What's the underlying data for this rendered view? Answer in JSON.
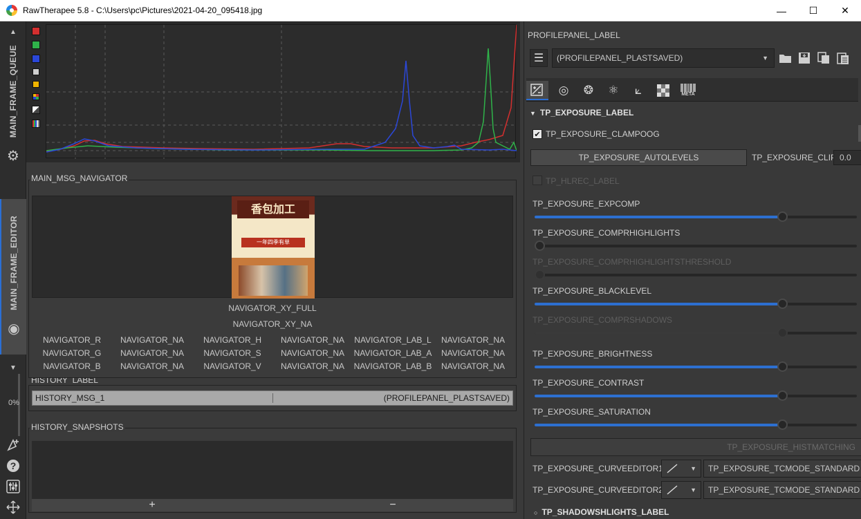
{
  "window": {
    "title": "RawTherapee 5.8 - C:\\Users\\pc\\Pictures\\2021-04-20_095418.jpg",
    "minimize": "—",
    "maximize": "☐",
    "close": "✕"
  },
  "sidebar": {
    "queue_tab": "MAIN_FRAME_QUEUE",
    "editor_tab": "MAIN_FRAME_EDITOR",
    "progress": "0%"
  },
  "navigator": {
    "label": "MAIN_MSG_NAVIGATOR",
    "xy_full": "NAVIGATOR_XY_FULL",
    "xy_na": "NAVIGATOR_XY_NA",
    "grid": [
      [
        "NAVIGATOR_R",
        "NAVIGATOR_NA",
        "NAVIGATOR_H",
        "NAVIGATOR_NA",
        "NAVIGATOR_LAB_L",
        "NAVIGATOR_NA"
      ],
      [
        "NAVIGATOR_G",
        "NAVIGATOR_NA",
        "NAVIGATOR_S",
        "NAVIGATOR_NA",
        "NAVIGATOR_LAB_A",
        "NAVIGATOR_NA"
      ],
      [
        "NAVIGATOR_B",
        "NAVIGATOR_NA",
        "NAVIGATOR_V",
        "NAVIGATOR_NA",
        "NAVIGATOR_LAB_B",
        "NAVIGATOR_NA"
      ]
    ],
    "thumb_title": "香包加工",
    "thumb_sub": "一年四季有单"
  },
  "history": {
    "label": "HISTORY_LABEL",
    "row_left": "HISTORY_MSG_1",
    "row_right": "(PROFILEPANEL_PLASTSAVED)"
  },
  "snapshots": {
    "label": "HISTORY_SNAPSHOTS",
    "add": "+",
    "remove": "−"
  },
  "profile": {
    "label": "PROFILEPANEL_LABEL",
    "value": "(PROFILEPANEL_PLASTSAVED)"
  },
  "tool_tabs": [
    "exposure-tab",
    "detail-tab",
    "color-tab",
    "advanced-tab",
    "transform-tab",
    "raw-tab",
    "meta-tab"
  ],
  "meta_tab_label": "META",
  "exposure": {
    "section": "TP_EXPOSURE_LABEL",
    "clamp": "TP_EXPOSURE_CLAMPOOG",
    "autolevels": "TP_EXPOSURE_AUTOLEVELS",
    "clip_label": "TP_EXPOSURE_CLIP",
    "clip_value": "0.0",
    "hlrec": "TP_HLREC_LABEL",
    "expcomp": "TP_EXPOSURE_EXPCOMP",
    "comprhighlights": "TP_EXPOSURE_COMPRHIGHLIGHTS",
    "comprhighlightsthreshold": "TP_EXPOSURE_COMPRHIGHLIGHTSTHRESHOLD",
    "blacklevel": "TP_EXPOSURE_BLACKLEVEL",
    "comprshadows": "TP_EXPOSURE_COMPRSHADOWS",
    "brightness": "TP_EXPOSURE_BRIGHTNESS",
    "contrast": "TP_EXPOSURE_CONTRAST",
    "saturation": "TP_EXPOSURE_SATURATION",
    "histmatching": "TP_EXPOSURE_HISTMATCHING",
    "curveeditor1": "TP_EXPOSURE_CURVEEDITOR1:",
    "curveeditor2": "TP_EXPOSURE_CURVEEDITOR2:",
    "tcmode": "TP_EXPOSURE_TCMODE_STANDARD",
    "slider_levels": {
      "expcomp": 0.7,
      "comprhighlights": 0.0,
      "blacklevel": 0.7,
      "brightness": 0.7,
      "contrast": 0.7,
      "saturation": 0.7
    }
  },
  "shadows": {
    "section": "TP_SHADOWSHLIGHTS_LABEL"
  }
}
